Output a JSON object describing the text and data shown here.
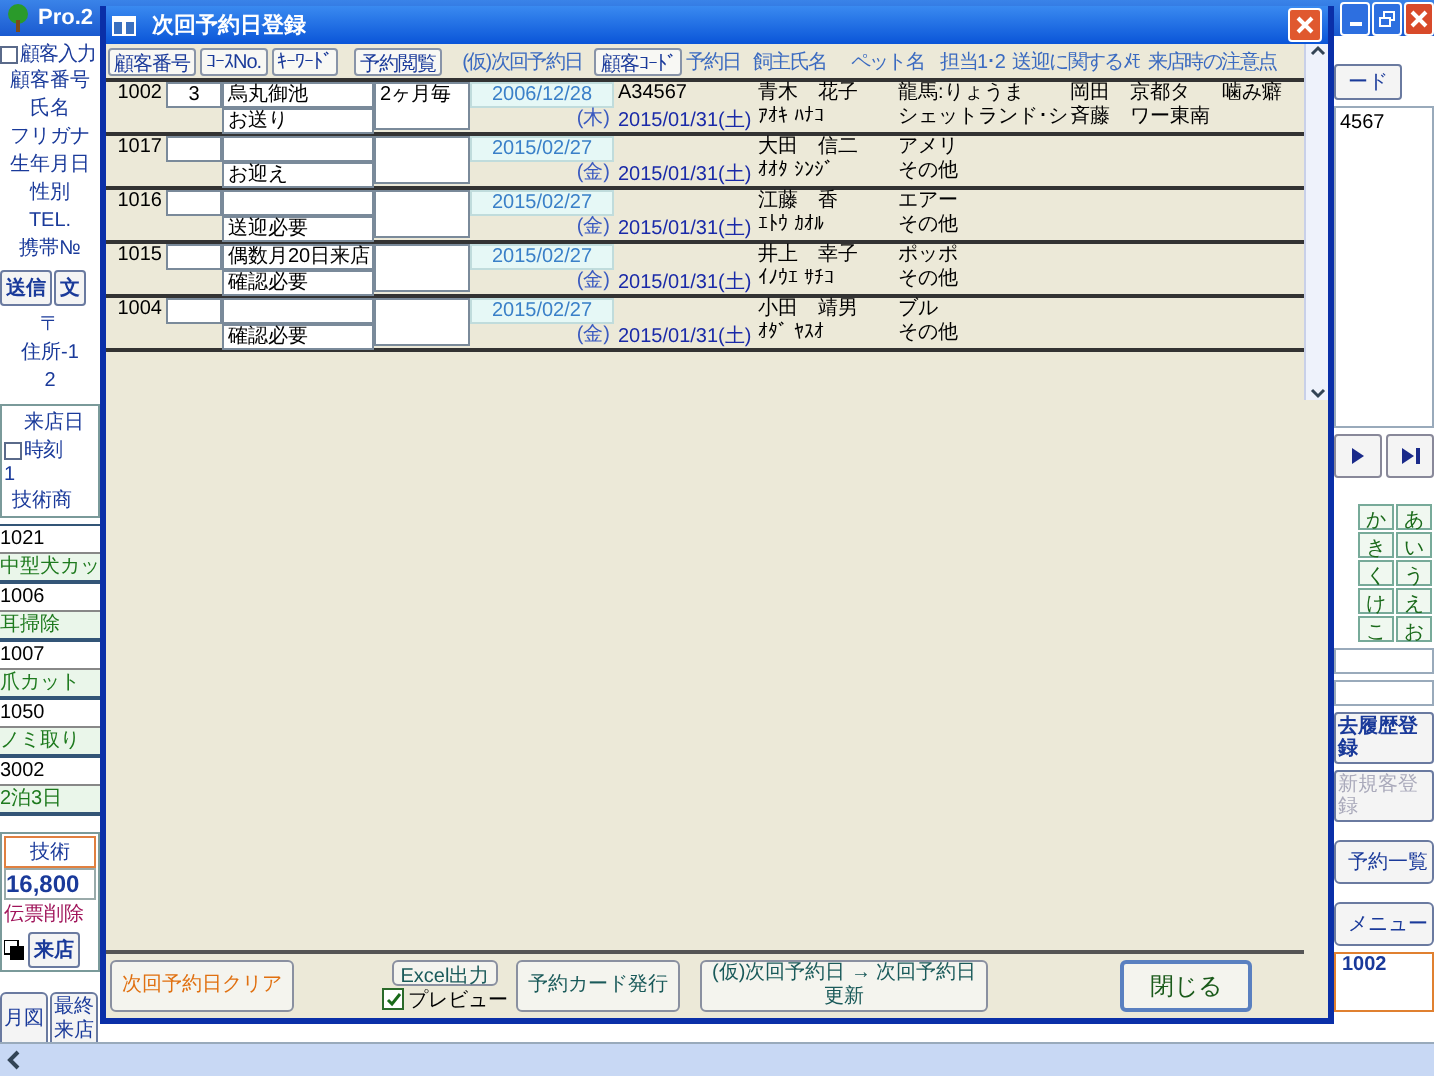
{
  "app": {
    "title": "Pro.2"
  },
  "left_panel": {
    "customer_input": {
      "label": "顧客入力",
      "checked": false
    },
    "fields": [
      "顧客番号",
      "氏名",
      "フリガナ",
      "生年月日",
      "性別",
      "TEL.",
      "携帯№"
    ],
    "buttons": [
      "送信",
      "文"
    ],
    "address": [
      "〒",
      "住所-1",
      "2"
    ],
    "visit": {
      "date_label": "来店日",
      "time_label": "時刻",
      "time_checked": false,
      "index": "1",
      "heading": "技術商"
    },
    "items": [
      {
        "code": "1021",
        "name": "中型犬カッ"
      },
      {
        "code": "1006",
        "name": "耳掃除"
      },
      {
        "code": "1007",
        "name": "爪カット"
      },
      {
        "code": "1050",
        "name": "ノミ取り"
      },
      {
        "code": "3002",
        "name": "2泊3日"
      }
    ],
    "total": {
      "label": "技術",
      "amount": "16,800"
    },
    "delete_label": "伝票削除",
    "visit_button": "来店",
    "bottom_buttons": [
      "月図",
      "最終来店"
    ]
  },
  "right_panel": {
    "code_button": "ード",
    "list": [
      "4567"
    ],
    "kana": [
      "か",
      "あ",
      "き",
      "い",
      "く",
      "う",
      "け",
      "え",
      "こ",
      "お"
    ],
    "history_button": "去履歴登録",
    "new_button": {
      "label": "新規客登録",
      "disabled": true
    },
    "buttons": [
      "予約一覧",
      "メニュー"
    ],
    "card": "1002"
  },
  "dialog": {
    "title": "次回予約日登録",
    "header_buttons": [
      "顧客番号",
      "ｺｰｽNo.",
      "ｷｰﾜｰﾄﾞ",
      "予約閲覧"
    ],
    "next_date_label": "(仮)次回予約日",
    "code_button": "顧客ｺｰﾄﾞ",
    "column_labels": [
      "予約日",
      "飼主氏名",
      "ペット名",
      "担当1･2",
      "送迎に関するﾒﾓ",
      "来店時の注意点"
    ],
    "rows": [
      {
        "id": "1002",
        "course": "3",
        "memo_top": "烏丸御池",
        "memo_bottom": "お送り",
        "keyword": "2ヶ月毎",
        "next_date": "2006/12/28",
        "next_day": "(木)",
        "code": "A34567",
        "booked": "2015/01/31(土)",
        "owner": "青木　花子",
        "owner_kana": "ｱｵｷ ﾊﾅｺ",
        "pet": "龍馬:りょうま",
        "breed": "シェットランド･シ",
        "staff": [
          "岡田",
          "斉藤"
        ],
        "pickup": [
          "京都タ",
          "ワー東南"
        ],
        "notes": "噛み癖"
      },
      {
        "id": "1017",
        "memo_bottom": "お迎え",
        "next_date": "2015/02/27",
        "next_day": "(金)",
        "booked": "2015/01/31(土)",
        "owner": "大田　信二",
        "owner_kana": "ｵｵﾀ ｼﾝｼﾞ",
        "pet": "アメリ",
        "breed": "その他"
      },
      {
        "id": "1016",
        "memo_bottom": "送迎必要",
        "next_date": "2015/02/27",
        "next_day": "(金)",
        "booked": "2015/01/31(土)",
        "owner": "江藤　香",
        "owner_kana": "ｴﾄｳ ｶｵﾙ",
        "pet": "エアー",
        "breed": "その他"
      },
      {
        "id": "1015",
        "memo_top": "偶数月20日来店",
        "memo_bottom": "確認必要",
        "next_date": "2015/02/27",
        "next_day": "(金)",
        "booked": "2015/01/31(土)",
        "owner": "井上　幸子",
        "owner_kana": "ｲﾉｳｴ ｻﾁｺ",
        "pet": "ポッポ",
        "breed": "その他"
      },
      {
        "id": "1004",
        "memo_bottom": "確認必要",
        "next_date": "2015/02/27",
        "next_day": "(金)",
        "booked": "2015/01/31(土)",
        "owner": "小田　靖男",
        "owner_kana": "ｵﾀﾞ ﾔｽｵ",
        "pet": "ブル",
        "breed": "その他"
      }
    ],
    "footer": {
      "clear_button": "次回予約日クリア",
      "excel_button": "Excel出力",
      "preview": {
        "label": "プレビュー",
        "checked": true
      },
      "card_button": "予約カード発行",
      "update_button": [
        "(仮)次回予約日 → 次回予約日",
        "更新"
      ],
      "close_button": "閉じる"
    }
  }
}
